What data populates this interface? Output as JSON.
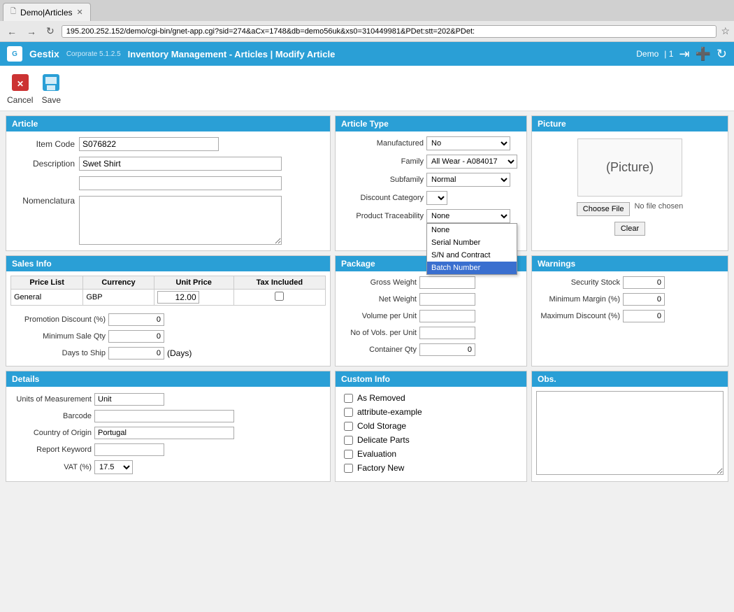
{
  "browser": {
    "tab_title": "Demo|Articles",
    "address": "195.200.252.152/demo/cgi-bin/gnet-app.cgi?sid=274&aCx=1748&db=demo56uk&xs0=310449981&PDet:stt=202&PDet:"
  },
  "app": {
    "brand": "Gestix",
    "version": "Corporate 5.1.2.5",
    "title": "Inventory Management - Articles | Modify Article",
    "demo_label": "Demo",
    "user_count": "| 1"
  },
  "toolbar": {
    "cancel_label": "Cancel",
    "save_label": "Save"
  },
  "article": {
    "section_title": "Article",
    "item_code_label": "Item Code",
    "item_code_value": "S076822",
    "description_label": "Description",
    "description_value": "Swet Shirt",
    "description2_value": "",
    "nomenclatura_label": "Nomenclatura",
    "nomenclatura_value": ""
  },
  "article_type": {
    "section_title": "Article Type",
    "manufactured_label": "Manufactured",
    "manufactured_value": "No",
    "family_label": "Family",
    "family_value": "All Wear - A084017",
    "subfamily_label": "Subfamily",
    "subfamily_value": "Normal",
    "discount_label": "Discount Category",
    "discount_value": "",
    "traceability_label": "Product Traceability",
    "traceability_value": "None",
    "dropdown_items": [
      "None",
      "Serial Number",
      "S/N and Contract",
      "Batch Number"
    ],
    "dropdown_selected": "Batch Number"
  },
  "picture": {
    "section_title": "Picture",
    "placeholder": "(Picture)",
    "choose_file_label": "Choose File",
    "no_file_label": "No file chosen",
    "clear_label": "Clear"
  },
  "sales_info": {
    "section_title": "Sales Info",
    "price_list_header": "Price List",
    "currency_header": "Currency",
    "unit_price_header": "Unit Price",
    "tax_included_header": "Tax Included",
    "price_list_value": "General",
    "currency_value": "GBP",
    "unit_price_value": "12.00",
    "promotion_label": "Promotion Discount (%)",
    "promotion_value": "0",
    "min_sale_qty_label": "Minimum Sale Qty",
    "min_sale_qty_value": "0",
    "days_to_ship_label": "Days to Ship",
    "days_to_ship_value": "0",
    "days_unit": "(Days)"
  },
  "package": {
    "section_title": "Package",
    "gross_weight_label": "Gross Weight",
    "gross_weight_value": "",
    "net_weight_label": "Net Weight",
    "net_weight_value": "",
    "volume_per_unit_label": "Volume per Unit",
    "volume_per_unit_value": "",
    "no_vols_label": "No of Vols. per Unit",
    "no_vols_value": "",
    "container_qty_label": "Container Qty",
    "container_qty_value": "0"
  },
  "warnings": {
    "section_title": "Warnings",
    "security_stock_label": "Security Stock",
    "security_stock_value": "0",
    "min_margin_label": "Minimum Margin (%)",
    "min_margin_value": "0",
    "max_discount_label": "Maximum Discount (%)",
    "max_discount_value": "0"
  },
  "details": {
    "section_title": "Details",
    "uom_label": "Units of Measurement",
    "uom_value": "Unit",
    "barcode_label": "Barcode",
    "barcode_value": "",
    "country_label": "Country of Origin",
    "country_value": "Portugal",
    "report_keyword_label": "Report Keyword",
    "report_keyword_value": "",
    "vat_label": "VAT (%)",
    "vat_value": "17.5"
  },
  "custom_info": {
    "section_title": "Custom Info",
    "items": [
      {
        "label": "As Removed",
        "checked": false
      },
      {
        "label": "attribute-example",
        "checked": false
      },
      {
        "label": "Cold Storage",
        "checked": false
      },
      {
        "label": "Delicate Parts",
        "checked": false
      },
      {
        "label": "Evaluation",
        "checked": false
      },
      {
        "label": "Factory New",
        "checked": false
      }
    ]
  },
  "obs": {
    "section_title": "Obs.",
    "value": ""
  }
}
